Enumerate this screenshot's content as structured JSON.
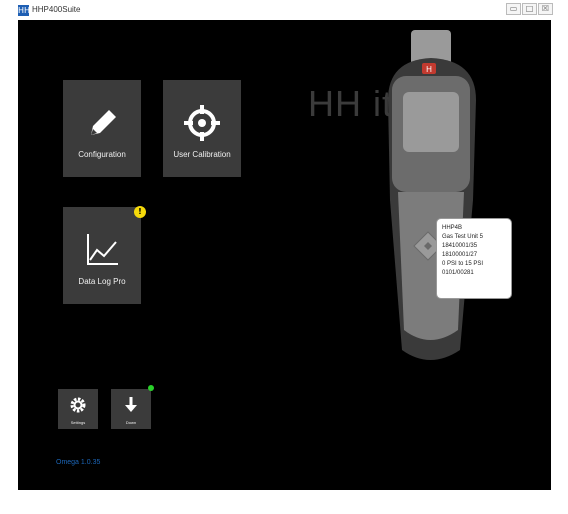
{
  "window": {
    "title": "HHP400Suite",
    "app_icon": "HH",
    "minimize_glyph": "▭",
    "maximize_glyph": "□",
    "close_glyph": "☒"
  },
  "watermark": "HH           ite",
  "tiles": {
    "configuration": {
      "label": "Configuration",
      "icon": "pencil-icon"
    },
    "user_calibration": {
      "label": "User Calibration",
      "icon": "crosshair-icon"
    },
    "data_log_pro": {
      "label": "Data Log Pro",
      "icon": "line-chart-icon",
      "badge": "!"
    },
    "settings": {
      "label": "Settings",
      "icon": "gear-icon"
    },
    "download": {
      "label": "Down",
      "icon": "download-arrow-icon"
    }
  },
  "device": {
    "logo": "H",
    "info_lines": [
      "HHP4B",
      "Gas Test Unit 5",
      "18410001/35",
      "18100001/27",
      "0 PSI to 15 PSI",
      "0101/00281"
    ]
  },
  "version_link": "Omega 1.0.35",
  "colors": {
    "background": "#000000",
    "tile": "#3b3b3b",
    "warning": "#f5d90a",
    "status_green": "#29d12a",
    "device_grip": "#7c7c7c"
  }
}
